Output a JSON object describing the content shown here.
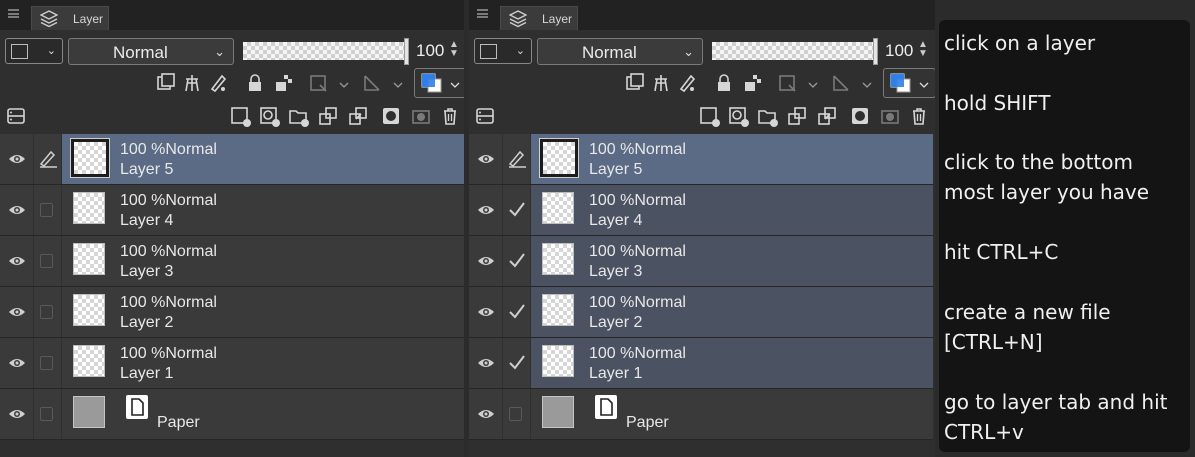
{
  "panels": [
    {
      "tab_title": "Layer",
      "blend_mode": "Normal",
      "opacity": "100",
      "layers": [
        {
          "opacity_text": "100 %",
          "mode": "Normal",
          "name": "Layer 5",
          "state": "selected"
        },
        {
          "opacity_text": "100 %",
          "mode": "Normal",
          "name": "Layer 4",
          "state": "normal"
        },
        {
          "opacity_text": "100 %",
          "mode": "Normal",
          "name": "Layer 3",
          "state": "normal"
        },
        {
          "opacity_text": "100 %",
          "mode": "Normal",
          "name": "Layer 2",
          "state": "normal"
        },
        {
          "opacity_text": "100 %",
          "mode": "Normal",
          "name": "Layer 1",
          "state": "normal"
        },
        {
          "name": "Paper",
          "state": "paper"
        }
      ]
    },
    {
      "tab_title": "Layer",
      "blend_mode": "Normal",
      "opacity": "100",
      "layers": [
        {
          "opacity_text": "100 %",
          "mode": "Normal",
          "name": "Layer 5",
          "state": "selected"
        },
        {
          "opacity_text": "100 %",
          "mode": "Normal",
          "name": "Layer 4",
          "state": "multi-selected"
        },
        {
          "opacity_text": "100 %",
          "mode": "Normal",
          "name": "Layer 3",
          "state": "multi-selected"
        },
        {
          "opacity_text": "100 %",
          "mode": "Normal",
          "name": "Layer 2",
          "state": "multi-selected"
        },
        {
          "opacity_text": "100 %",
          "mode": "Normal",
          "name": "Layer 1",
          "state": "multi-selected"
        },
        {
          "name": "Paper",
          "state": "paper"
        }
      ]
    }
  ],
  "instructions": {
    "lines": [
      "click on a layer",
      "hold SHIFT",
      "click to the bottom",
      "most layer you have",
      "hit CTRL+C",
      "create a new file",
      "[CTRL+N]",
      "go to layer tab and hit",
      "CTRL+v"
    ]
  },
  "colors": {
    "selected_row": "#5b6a85",
    "multi_selected_row": "#4b5261",
    "row": "#3a3a3a",
    "accent_blue": "#2f7fe8"
  }
}
